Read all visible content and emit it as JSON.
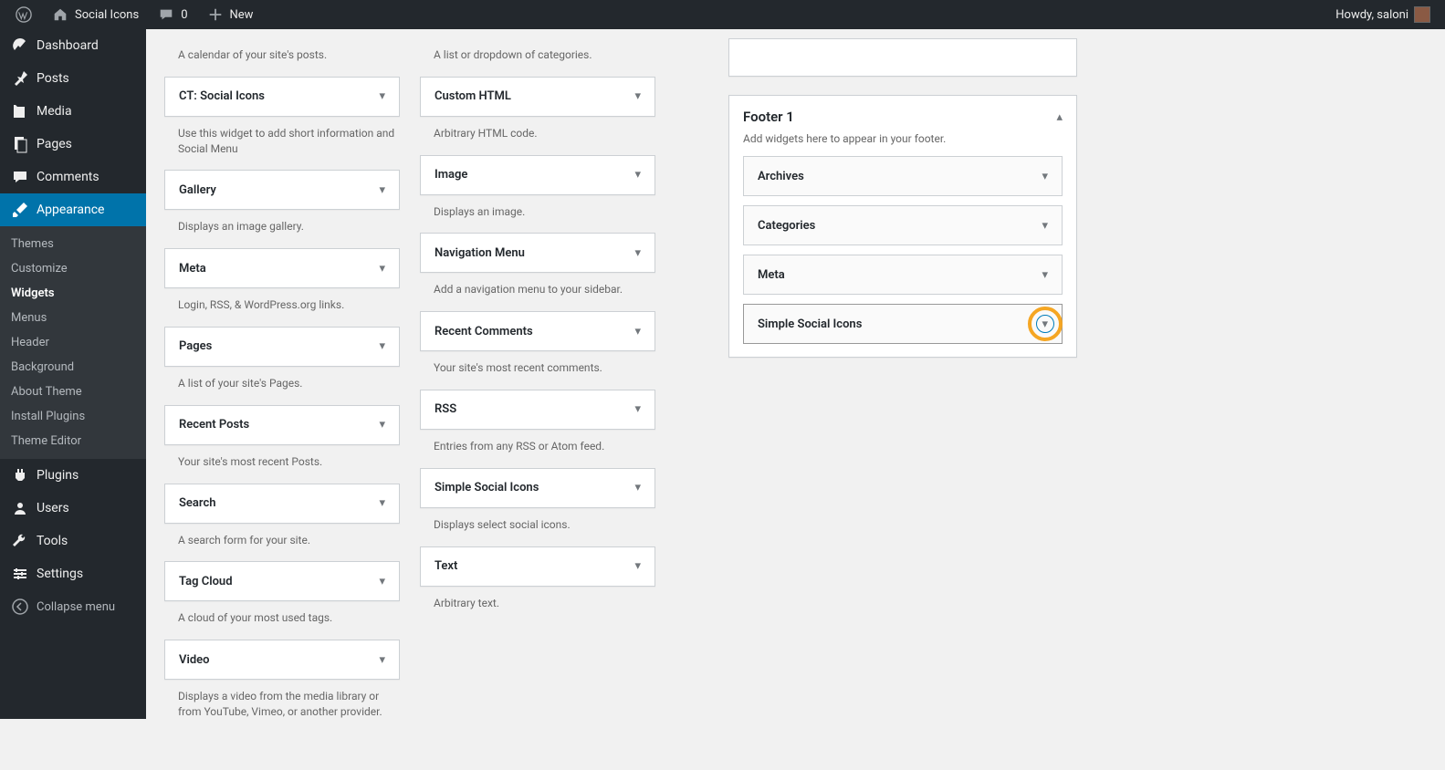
{
  "adminbar": {
    "site_name": "Social Icons",
    "comments_count": "0",
    "new_label": "New",
    "howdy": "Howdy, saloni"
  },
  "menu": {
    "dashboard": "Dashboard",
    "posts": "Posts",
    "media": "Media",
    "pages": "Pages",
    "comments": "Comments",
    "appearance": "Appearance",
    "plugins": "Plugins",
    "users": "Users",
    "tools": "Tools",
    "settings": "Settings",
    "collapse": "Collapse menu"
  },
  "submenu": {
    "themes": "Themes",
    "customize": "Customize",
    "widgets": "Widgets",
    "menus": "Menus",
    "header": "Header",
    "background": "Background",
    "about_theme": "About Theme",
    "install_plugins": "Install Plugins",
    "theme_editor": "Theme Editor"
  },
  "left_col": [
    {
      "desc_above": "A calendar of your site's posts.",
      "title": "CT: Social Icons",
      "desc": "Use this widget to add short information and Social Menu"
    },
    {
      "title": "Gallery",
      "desc": "Displays an image gallery."
    },
    {
      "title": "Meta",
      "desc": "Login, RSS, & WordPress.org links."
    },
    {
      "title": "Pages",
      "desc": "A list of your site's Pages."
    },
    {
      "title": "Recent Posts",
      "desc": "Your site's most recent Posts."
    },
    {
      "title": "Search",
      "desc": "A search form for your site."
    },
    {
      "title": "Tag Cloud",
      "desc": "A cloud of your most used tags."
    },
    {
      "title": "Video",
      "desc": "Displays a video from the media library or from YouTube, Vimeo, or another provider."
    }
  ],
  "right_col": [
    {
      "desc_above": "A list or dropdown of categories.",
      "title": "Custom HTML",
      "desc": "Arbitrary HTML code."
    },
    {
      "title": "Image",
      "desc": "Displays an image."
    },
    {
      "title": "Navigation Menu",
      "desc": "Add a navigation menu to your sidebar."
    },
    {
      "title": "Recent Comments",
      "desc": "Your site's most recent comments."
    },
    {
      "title": "RSS",
      "desc": "Entries from any RSS or Atom feed."
    },
    {
      "title": "Simple Social Icons",
      "desc": "Displays select social icons."
    },
    {
      "title": "Text",
      "desc": "Arbitrary text."
    }
  ],
  "footer_area": {
    "title": "Footer 1",
    "desc": "Add widgets here to appear in your footer.",
    "widgets": [
      {
        "title": "Archives"
      },
      {
        "title": "Categories"
      },
      {
        "title": "Meta"
      },
      {
        "title": "Simple Social Icons",
        "highlight": true
      }
    ]
  }
}
